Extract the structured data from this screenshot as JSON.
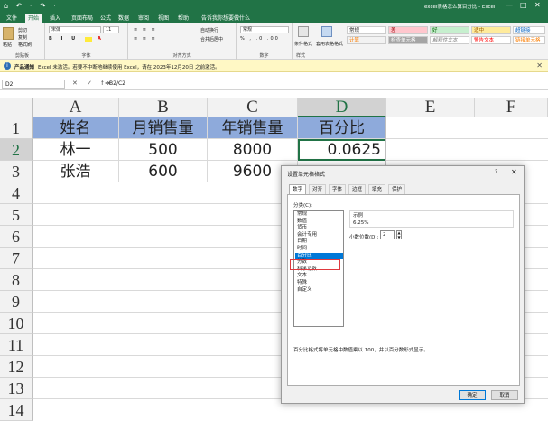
{
  "window": {
    "title": "excel表格怎么算百分比 - Excel",
    "qat": "⌂ ↶ · ↷ ·",
    "controls": [
      "—",
      "□",
      "✕"
    ]
  },
  "tabs": [
    "文件",
    "开始",
    "插入",
    "页面布局",
    "公式",
    "数据",
    "审阅",
    "视图",
    "帮助",
    "告诉我你想要做什么"
  ],
  "active_tab_index": 1,
  "ribbon": {
    "clipboard": {
      "paste": "粘贴",
      "cut": "剪切",
      "copy": "复制",
      "painter": "格式刷",
      "label": "剪贴板"
    },
    "font": {
      "name": "宋体",
      "size": "11",
      "label": "字体"
    },
    "alignment": {
      "wrap": "自动换行",
      "merge": "合并后居中",
      "label": "对齐方式"
    },
    "number": {
      "format": "常规",
      "label": "数字"
    },
    "styles_group": {
      "conditional": "条件格式",
      "table": "套用表格格式",
      "label": "样式"
    },
    "styles": [
      {
        "text": "常规",
        "bg": "#ffffff",
        "color": "#222222"
      },
      {
        "text": "差",
        "bg": "#ffc7ce",
        "color": "#9c0006"
      },
      {
        "text": "好",
        "bg": "#c6efce",
        "color": "#006100"
      },
      {
        "text": "适中",
        "bg": "#ffeb9c",
        "color": "#9c5700"
      },
      {
        "text": "超链接",
        "bg": "#ffffff",
        "color": "#0563c1"
      },
      {
        "text": "计算",
        "bg": "#f2f2f2",
        "color": "#fa7d00"
      },
      {
        "text": "检查单元格",
        "bg": "#a5a5a5",
        "color": "#ffffff"
      },
      {
        "text": "解释性文本",
        "bg": "#ffffff",
        "color": "#7f7f7f"
      },
      {
        "text": "警告文本",
        "bg": "#ffffff",
        "color": "#ff0000"
      },
      {
        "text": "链接单元格",
        "bg": "#ffffff",
        "color": "#fa7d00"
      }
    ]
  },
  "notice": {
    "label": "产品通知",
    "message": "Excel 未激活。若要不中断地继续使用 Excel，请在 2023年12月20日 之前激活。",
    "close": "✕"
  },
  "formula_bar": {
    "name_box": "D2",
    "fx": "✕ ✓ fx",
    "formula": "=B2/C2"
  },
  "columns": [
    "A",
    "B",
    "C",
    "D",
    "E",
    "F"
  ],
  "rows": [
    "1",
    "2",
    "3",
    "4",
    "5",
    "6",
    "7",
    "8",
    "9",
    "10",
    "11",
    "12",
    "13",
    "14"
  ],
  "cells": {
    "A1": "姓名",
    "B1": "月销售量",
    "C1": "年销售量",
    "D1": "百分比",
    "A2": "林一",
    "B2": "500",
    "C2": "8000",
    "D2": "0.0625",
    "A3": "张浩",
    "B3": "600",
    "C3": "9600"
  },
  "colors": {
    "excel_green": "#217346",
    "header_fill": "#8eaadb",
    "selection": "#0078d7",
    "highlight": "#e0393e"
  },
  "dialog": {
    "title": "设置单元格格式",
    "help": "?",
    "close": "✕",
    "tabs": [
      "数字",
      "对齐",
      "字体",
      "边框",
      "填充",
      "保护"
    ],
    "active_tab_index": 0,
    "category_label": "分类(C):",
    "categories": [
      "常规",
      "数值",
      "货币",
      "会计专用",
      "日期",
      "时间",
      "百分比",
      "分数",
      "科学记数",
      "文本",
      "特殊",
      "自定义"
    ],
    "selected_category_index": 6,
    "sample_label": "示例",
    "sample_value": "6.25%",
    "decimal_label": "小数位数(D):",
    "decimal_value": "2",
    "description": "百分比格式将单元格中数值乘以 100，并以百分数形式显示。",
    "ok": "确定",
    "cancel": "取消"
  }
}
